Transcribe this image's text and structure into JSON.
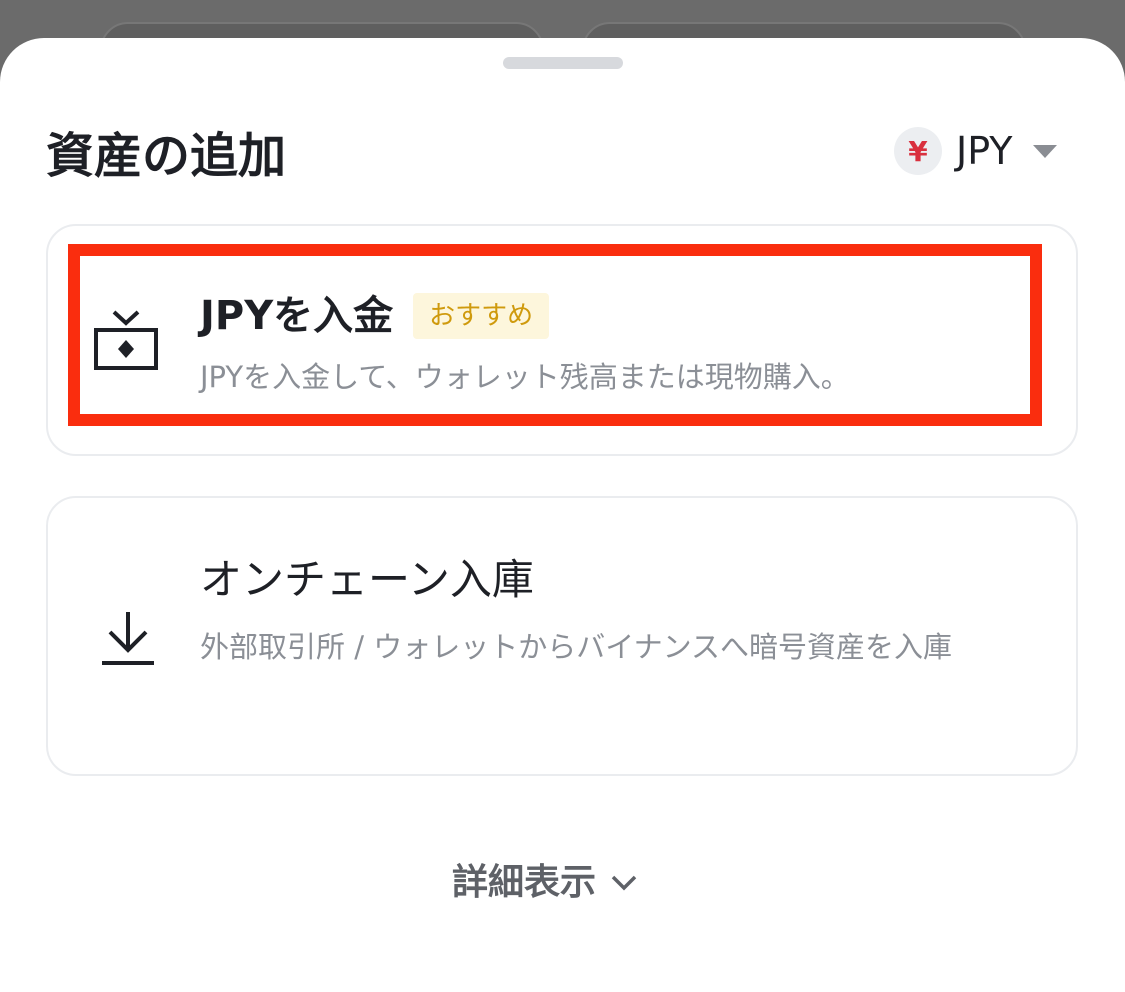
{
  "sheet": {
    "title": "資産の追加",
    "currency": {
      "symbol": "¥",
      "code": "JPY"
    }
  },
  "options": [
    {
      "title": "JPYを入金",
      "tag": "おすすめ",
      "description": "JPYを入金して、ウォレット残高または現物購入。",
      "icon": "deposit-fiat-icon"
    },
    {
      "title": "オンチェーン入庫",
      "description": "外部取引所 / ウォレットからバイナンスへ暗号資産を入庫",
      "icon": "download-arrow-icon"
    }
  ],
  "more": {
    "label": "詳細表示",
    "icon": "chevron-down-icon"
  },
  "colors": {
    "highlight": "#fa2d0e",
    "tag_text": "#cf9a0d",
    "tag_bg": "#fdf6dc",
    "yen": "#d9303e"
  }
}
